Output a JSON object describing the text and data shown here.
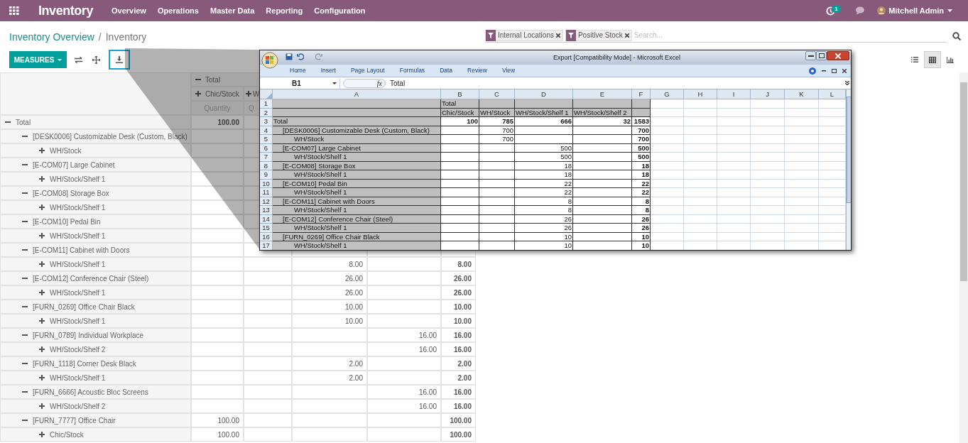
{
  "navbar": {
    "app_title": "Inventory",
    "menu": [
      "Overview",
      "Operations",
      "Master Data",
      "Reporting",
      "Configuration"
    ],
    "activity_count": "1",
    "user": "Mitchell Admin"
  },
  "breadcrumb": {
    "separator": "/",
    "items": [
      "Inventory Overview",
      "Inventory"
    ]
  },
  "search": {
    "facets": [
      "Internal Locations",
      "Positive Stock"
    ],
    "placeholder": "Search..."
  },
  "toolbar": {
    "measures_button": "MEASURES",
    "views": [
      {
        "kind": "list",
        "selected": false
      },
      {
        "kind": "pivot",
        "selected": true
      },
      {
        "kind": "graph",
        "selected": false
      }
    ]
  },
  "pivot": {
    "column_header": {
      "label": "Total",
      "expanded": true,
      "children": [
        {
          "label": "Chic/Stock",
          "expanded": false,
          "measure": "Quantity"
        },
        {
          "label": "W",
          "expanded": false,
          "measure": "Q"
        }
      ]
    },
    "rows": [
      {
        "label": "Total",
        "expanded": true,
        "values": {
          "column_1": "100.00"
        },
        "children": [
          {
            "label": "[DESK0006] Customizable Desk (Custom, Black)",
            "expanded": true,
            "children": [
              {
                "label": "WH/Stock",
                "expanded": false
              }
            ]
          },
          {
            "label": "[E-COM07] Large Cabinet",
            "expanded": true,
            "children": [
              {
                "label": "WH/Stock/Shelf 1",
                "expanded": false
              }
            ]
          },
          {
            "label": "[E-COM08] Storage Box",
            "expanded": true,
            "children": [
              {
                "label": "WH/Stock/Shelf 1",
                "expanded": false
              }
            ]
          },
          {
            "label": "[E-COM10] Pedal Bin",
            "expanded": true,
            "children": [
              {
                "label": "WH/Stock/Shelf 1",
                "expanded": false
              }
            ]
          },
          {
            "label": "[E-COM11] Cabinet with Doors",
            "expanded": true,
            "children": [
              {
                "label": "WH/Stock/Shelf 1",
                "expanded": false,
                "values": {
                  "column_3": "8.00",
                  "total": "8.00"
                }
              }
            ]
          },
          {
            "label": "[E-COM12] Conference Chair (Steel)",
            "expanded": true,
            "values": {
              "column_3": "26.00",
              "total": "26.00"
            },
            "children": [
              {
                "label": "WH/Stock/Shelf 1",
                "expanded": false,
                "values": {
                  "column_3": "26.00",
                  "total": "26.00"
                }
              }
            ]
          },
          {
            "label": "[FURN_0269] Office Chair Black",
            "expanded": true,
            "values": {
              "column_3": "10.00",
              "total": "10.00"
            },
            "children": [
              {
                "label": "WH/Stock/Shelf 1",
                "expanded": false,
                "values": {
                  "column_3": "10.00",
                  "total": "10.00"
                }
              }
            ]
          },
          {
            "label": "[FURN_0789] Individual Workplace",
            "expanded": true,
            "values": {
              "column_4": "16.00",
              "total": "16.00"
            },
            "children": [
              {
                "label": "WH/Stock/Shelf 2",
                "expanded": false,
                "values": {
                  "column_4": "16.00",
                  "total": "16.00"
                }
              }
            ]
          },
          {
            "label": "[FURN_1118] Corner Desk Black",
            "expanded": true,
            "values": {
              "column_3": "2.00",
              "total": "2.00"
            },
            "children": [
              {
                "label": "WH/Stock/Shelf 1",
                "expanded": false,
                "values": {
                  "column_3": "2.00",
                  "total": "2.00"
                }
              }
            ]
          },
          {
            "label": "[FURN_6666] Acoustic Bloc Screens",
            "expanded": true,
            "values": {
              "column_4": "16.00",
              "total": "16.00"
            },
            "children": [
              {
                "label": "WH/Stock/Shelf 2",
                "expanded": false,
                "values": {
                  "column_4": "16.00",
                  "total": "16.00"
                }
              }
            ]
          },
          {
            "label": "[FURN_7777] Office Chair",
            "expanded": true,
            "values": {
              "column_1": "100.00",
              "total": "100.00"
            },
            "children": [
              {
                "label": "Chic/Stock",
                "expanded": false,
                "values": {
                  "column_1": "100.00",
                  "total": "100.00"
                }
              }
            ]
          }
        ]
      }
    ]
  },
  "excel": {
    "title": "Export [Compatibility Mode] - Microsoft Excel",
    "ribbon_tabs": [
      "Home",
      "Insert",
      "Page Layout",
      "Formulas",
      "Data",
      "Review",
      "View"
    ],
    "name_box": "B1",
    "function_label": "fx",
    "formula": "Total",
    "columns": [
      "A",
      "B",
      "C",
      "D",
      "E",
      "F",
      "G",
      "H",
      "I",
      "J",
      "K",
      "L"
    ],
    "rows": [
      {
        "n": "1",
        "kind": "header",
        "cells": {
          "B": "Total"
        }
      },
      {
        "n": "2",
        "kind": "header",
        "cells": {
          "B": "Chic/Stock",
          "C": "WH/Stock",
          "D": "WH/Stock/Shelf 1",
          "E": "WH/Stock/Shelf 2"
        }
      },
      {
        "n": "3",
        "kind": "total",
        "cells": {
          "A": "Total",
          "B": "100",
          "C": "785",
          "D": "666",
          "E": "32",
          "F": "1583"
        }
      },
      {
        "n": "4",
        "kind": "product",
        "cells": {
          "A": "[DESK0006] Customizable Desk (Custom, Black)",
          "C": "700",
          "F": "700"
        }
      },
      {
        "n": "5",
        "kind": "location",
        "cells": {
          "A": "WH/Stock",
          "C": "700",
          "F": "700"
        }
      },
      {
        "n": "6",
        "kind": "product",
        "cells": {
          "A": "[E-COM07] Large Cabinet",
          "D": "500",
          "F": "500"
        }
      },
      {
        "n": "7",
        "kind": "location",
        "cells": {
          "A": "WH/Stock/Shelf 1",
          "D": "500",
          "F": "500"
        }
      },
      {
        "n": "8",
        "kind": "product",
        "cells": {
          "A": "[E-COM08] Storage Box",
          "D": "18",
          "F": "18"
        }
      },
      {
        "n": "9",
        "kind": "location",
        "cells": {
          "A": "WH/Stock/Shelf 1",
          "D": "18",
          "F": "18"
        }
      },
      {
        "n": "10",
        "kind": "product",
        "cells": {
          "A": "[E-COM10] Pedal Bin",
          "D": "22",
          "F": "22"
        }
      },
      {
        "n": "11",
        "kind": "location",
        "cells": {
          "A": "WH/Stock/Shelf 1",
          "D": "22",
          "F": "22"
        }
      },
      {
        "n": "12",
        "kind": "product",
        "cells": {
          "A": "[E-COM11] Cabinet with Doors",
          "D": "8",
          "F": "8"
        }
      },
      {
        "n": "13",
        "kind": "location",
        "cells": {
          "A": "WH/Stock/Shelf 1",
          "D": "8",
          "F": "8"
        }
      },
      {
        "n": "14",
        "kind": "product",
        "cells": {
          "A": "[E-COM12] Conference Chair (Steel)",
          "D": "26",
          "F": "26"
        }
      },
      {
        "n": "15",
        "kind": "location",
        "cells": {
          "A": "WH/Stock/Shelf 1",
          "D": "26",
          "F": "26"
        }
      },
      {
        "n": "16",
        "kind": "product",
        "cells": {
          "A": "[FURN_0269] Office Chair Black",
          "D": "10",
          "F": "10"
        }
      },
      {
        "n": "17",
        "kind": "location",
        "cells": {
          "A": "WH/Stock/Shelf 1",
          "D": "10",
          "F": "10"
        }
      }
    ]
  }
}
